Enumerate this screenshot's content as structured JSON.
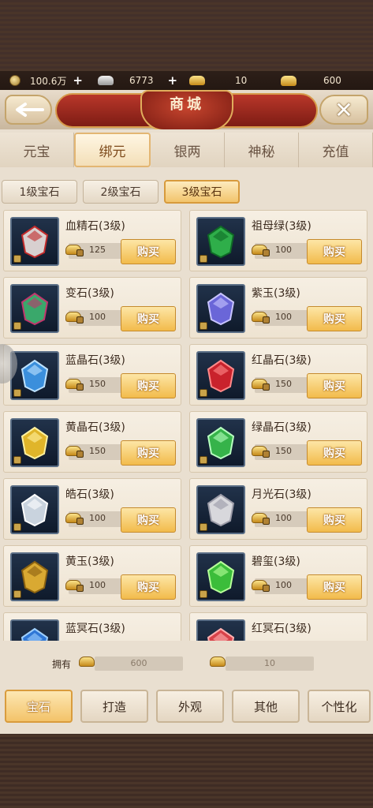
{
  "currency": {
    "copper": "100.6万",
    "silver": "6773",
    "gold": "10",
    "bound_gold": "600"
  },
  "header": {
    "title": "商城"
  },
  "tabs": [
    {
      "label": "元宝",
      "active": false
    },
    {
      "label": "绑元",
      "active": true
    },
    {
      "label": "银两",
      "active": false
    },
    {
      "label": "神秘",
      "active": false
    },
    {
      "label": "充值",
      "active": false
    }
  ],
  "subtabs": [
    {
      "label": "1级宝石",
      "active": false
    },
    {
      "label": "2级宝石",
      "active": false
    },
    {
      "label": "3级宝石",
      "active": true
    }
  ],
  "items": [
    {
      "name": "血精石(3级)",
      "price": "125",
      "buy": "购买",
      "color": "#d8d0d0",
      "accent": "#c22a2a"
    },
    {
      "name": "祖母绿(3级)",
      "price": "100",
      "buy": "购买",
      "color": "#2fae4a",
      "accent": "#0f6a26"
    },
    {
      "name": "变石(3级)",
      "price": "100",
      "buy": "购买",
      "color": "#3aa86b",
      "accent": "#c2366d"
    },
    {
      "name": "紫玉(3级)",
      "price": "100",
      "buy": "购买",
      "color": "#6a66d8",
      "accent": "#c8c4ff"
    },
    {
      "name": "蓝晶石(3级)",
      "price": "150",
      "buy": "购买",
      "color": "#3b8fdc",
      "accent": "#bfe3ff"
    },
    {
      "name": "红晶石(3级)",
      "price": "150",
      "buy": "购买",
      "color": "#c9222c",
      "accent": "#ff8a8a"
    },
    {
      "name": "黄晶石(3级)",
      "price": "150",
      "buy": "购买",
      "color": "#e0b52a",
      "accent": "#fff2a0"
    },
    {
      "name": "绿晶石(3级)",
      "price": "150",
      "buy": "购买",
      "color": "#36b34a",
      "accent": "#b8ffc0"
    },
    {
      "name": "皓石(3级)",
      "price": "100",
      "buy": "购买",
      "color": "#c9d3de",
      "accent": "#ffffff"
    },
    {
      "name": "月光石(3级)",
      "price": "100",
      "buy": "购买",
      "color": "#d8d8dc",
      "accent": "#9a9aa6"
    },
    {
      "name": "黄玉(3级)",
      "price": "100",
      "buy": "购买",
      "color": "#d9a932",
      "accent": "#8a6110"
    },
    {
      "name": "碧玺(3级)",
      "price": "100",
      "buy": "购买",
      "color": "#3bbd3a",
      "accent": "#b8ff9a"
    },
    {
      "name": "蓝冥石(3级)",
      "price": "",
      "buy": "",
      "color": "#2f77d6",
      "accent": "#9fd0ff"
    },
    {
      "name": "红冥石(3级)",
      "price": "",
      "buy": "",
      "color": "#d8424a",
      "accent": "#ffb0b0"
    }
  ],
  "owned": {
    "label": "拥有",
    "bound_gold": "600",
    "gold": "10"
  },
  "bottom_nav": [
    {
      "label": "宝石",
      "active": true
    },
    {
      "label": "打造",
      "active": false
    },
    {
      "label": "外观",
      "active": false
    },
    {
      "label": "其他",
      "active": false
    },
    {
      "label": "个性化",
      "active": false
    }
  ]
}
